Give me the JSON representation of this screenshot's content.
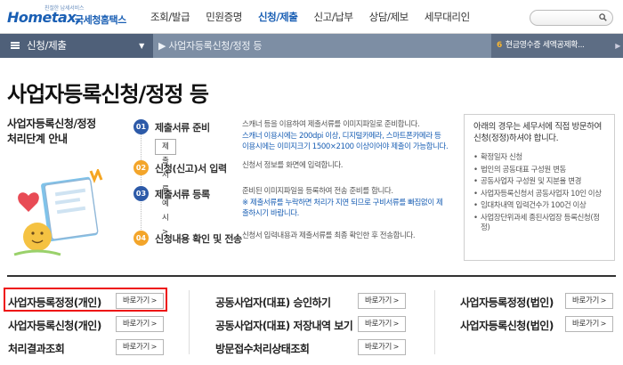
{
  "header": {
    "logo_tagline": "친절한 납세서비스",
    "logo_brand": "Hometax,",
    "logo_sub": "국세청홈택스",
    "menu": [
      "조회/발급",
      "민원증명",
      "신청/제출",
      "신고/납부",
      "상담/제보",
      "세무대리인"
    ],
    "active_menu": "신청/제출",
    "search_icon": "search-icon"
  },
  "subnav": {
    "section": "신청/제출",
    "breadcrumb": "사업자등록신청/정정 등",
    "notice_num": "6",
    "notice_text": "현금영수증 세액공제확..."
  },
  "page": {
    "title": "사업자등록신청/정정 등",
    "process_title_line1": "사업자등록신청/정정",
    "process_title_line2": "처리단계 안내"
  },
  "steps": [
    {
      "num": "01",
      "title": "제출서류 준비",
      "desc": "스캐너 등을 이용하여 제출서류를 이미지파일로 준비합니다.",
      "desc_blue": "스캐너 이용시에는 200dpi 이상, 디지털카메라, 스마트폰카메라 등 이용시에는 이미지크기 1500×2100 이상이어야 제출이 가능합니다.",
      "button": "제출서류예시 >",
      "color": "#2d5aa8"
    },
    {
      "num": "02",
      "title": "신청(신고)서 입력",
      "desc": "신청서 정보를 화면에 입력합니다.",
      "color": "#f3a52a"
    },
    {
      "num": "03",
      "title": "제출서류 등록",
      "desc": "준비된 이미지파일을 등록하여 전송 준비를 합니다.",
      "desc_blue": "※ 제출서류를 누락하면 처리가 지연 되므로 구비서류를 빠짐없이 제출하시기 바랍니다.",
      "color": "#2d5aa8"
    },
    {
      "num": "04",
      "title": "신청내용 확인 및 전송",
      "desc": "신청서 입력내용과 제출서류를 최종 확인한 후 전송합니다.",
      "color": "#f3a52a"
    }
  ],
  "infobox": {
    "intro": "아래의 경우는 세무서에 직접 방문하여 신청(정정)하셔야 합니다.",
    "items": [
      "확정일자 신청",
      "법인의 공동대표 구성원 변동",
      "공동사업자 구성원 및 지분율 변경",
      "사업자등록신청서 공동사업자 10인 이상",
      "임대차내역 입력건수가 100건 이상",
      "사업장단위과세 종된사업장 등록신청(정정)"
    ]
  },
  "quick_links": [
    {
      "label": "사업자등록정정(개인)",
      "button": "바로가기"
    },
    {
      "label": "공동사업자(대표) 승인하기",
      "button": "바로가기"
    },
    {
      "label": "사업자등록정정(법인)",
      "button": "바로가기"
    },
    {
      "label": "사업자등록신청(개인)",
      "button": "바로가기"
    },
    {
      "label": "공동사업자(대표) 저장내역 보기",
      "button": "바로가기"
    },
    {
      "label": "사업자등록신청(법인)",
      "button": "바로가기"
    },
    {
      "label": "처리결과조회",
      "button": "바로가기"
    },
    {
      "label": "방문접수처리상태조회",
      "button": "바로가기"
    }
  ]
}
